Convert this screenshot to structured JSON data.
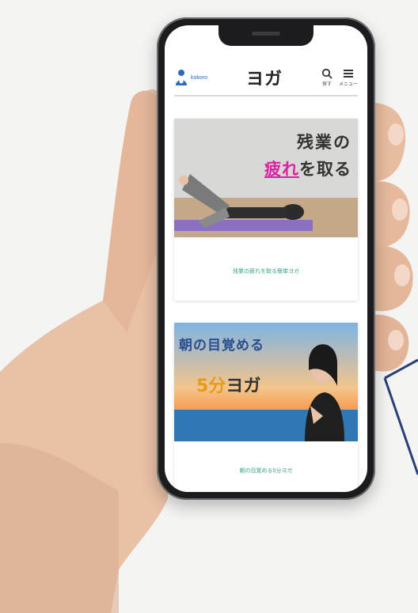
{
  "app": {
    "logo_text": "kokoro",
    "page_title": "ヨガ",
    "nav": [
      {
        "icon": "search-icon",
        "label": "探す"
      },
      {
        "icon": "menu-icon",
        "label": "メニュー"
      }
    ]
  },
  "cards": [
    {
      "thumb_line1": "残業の",
      "thumb_highlight": "疲れ",
      "thumb_line2_rest": "を取る",
      "caption": "残業の疲れを取る簡単ヨガ"
    },
    {
      "thumb_line1": "朝の目覚める",
      "thumb_number": "5分",
      "thumb_line2_rest": "ヨガ",
      "caption": "朝の目覚める5分ヨガ"
    }
  ],
  "colors": {
    "accent_caption": "#3aa38a",
    "highlight": "#d6249f",
    "logo_blue": "#2a6bc4"
  }
}
